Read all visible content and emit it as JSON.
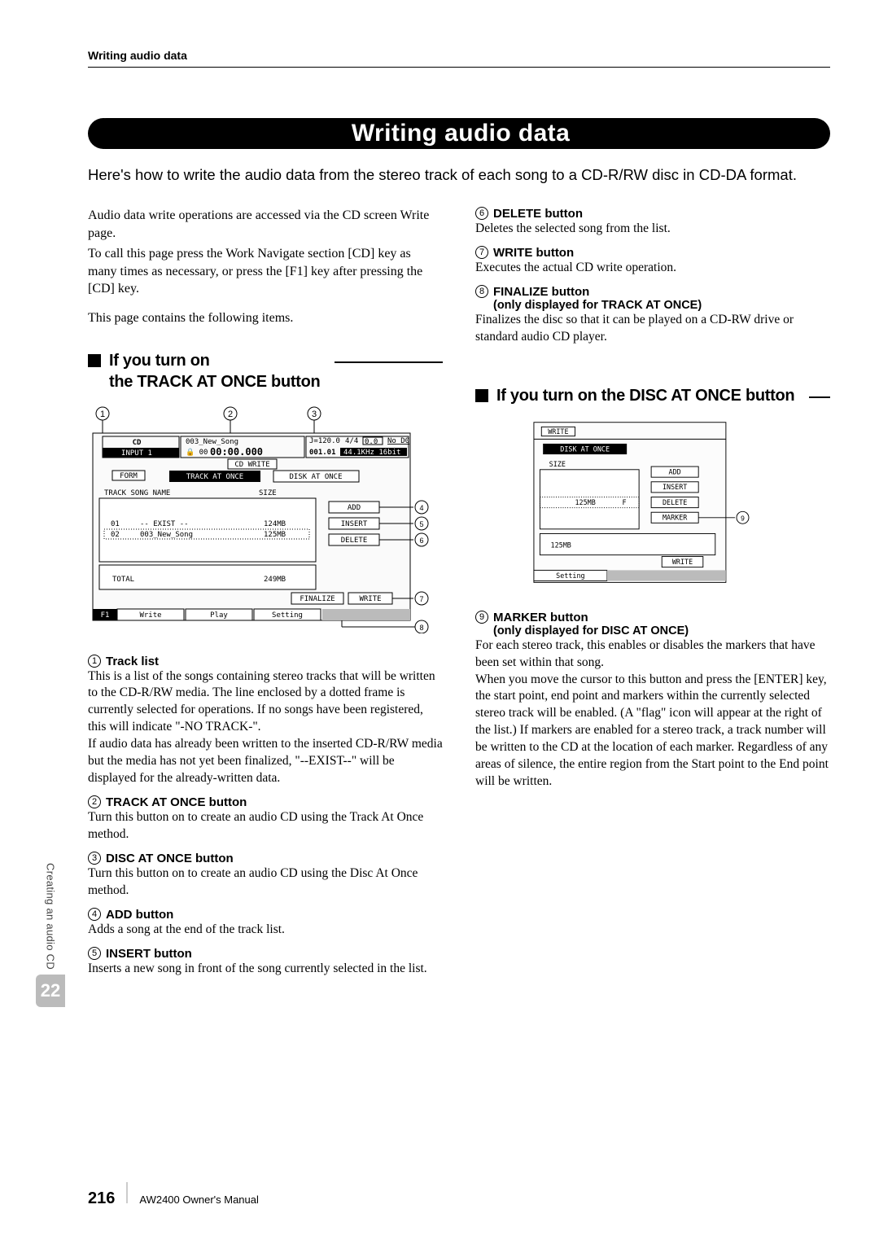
{
  "header": {
    "running_head": "Writing audio data"
  },
  "title": "Writing audio data",
  "intro": "Here's how to write the audio data from the stereo track of each song to a CD-R/RW disc in CD-DA format.",
  "left": {
    "para1": "Audio data write operations are accessed via the CD screen Write page.",
    "para2": "To call this page press the Work Navigate section [CD] key as many times as necessary, or press the [F1] key after pressing the [CD] key.",
    "para3": "This page contains the following items.",
    "section_heading_l1": "If you turn on",
    "section_heading_l2": "the TRACK AT ONCE button",
    "screenshot1": {
      "callouts": {
        "c1": "1",
        "c2": "2",
        "c3": "3",
        "c4": "4",
        "c5": "5",
        "c6": "6",
        "c7": "7",
        "c8": "8"
      },
      "top": {
        "screen_label": "CD",
        "input_label": "INPUT 1",
        "song": "003_New_Song",
        "time": "00:00.000",
        "lock": "🔒 00",
        "bpm": "J=120.0",
        "sig": "4/4",
        "bar": "001.01",
        "db": "No D0",
        "db2": "0.0",
        "sr": "44.1KHz 16bit"
      },
      "tabs": {
        "cd_write": "CD WRITE",
        "form": "FORM",
        "track_at_once": "TRACK AT ONCE",
        "disk_at_once": "DISK AT ONCE"
      },
      "labels": {
        "list_header1": "TRACK SONG NAME",
        "list_header2": "SIZE"
      },
      "rows": [
        {
          "num": "01",
          "name": "-- EXIST --",
          "size": "124MB"
        },
        {
          "num": "02",
          "name": "003_New_Song",
          "size": "125MB"
        }
      ],
      "buttons": {
        "add": "ADD",
        "insert": "INSERT",
        "delete": "DELETE",
        "finalize": "FINALIZE",
        "write": "WRITE"
      },
      "total": {
        "label": "TOTAL",
        "value": "249MB"
      },
      "footer_tabs": {
        "f1": "F1",
        "write": "Write",
        "play": "Play",
        "setting": "Setting"
      }
    },
    "items": {
      "i1": {
        "num": "1",
        "title": "Track list",
        "body": "This is a list of the songs containing stereo tracks that will be written to the CD-R/RW media. The line enclosed by a dotted frame is currently selected for operations. If no songs have been registered, this will indicate \"-NO TRACK-\".",
        "body2": "If audio data has already been written to the inserted CD-R/RW media but the media has not yet been finalized, \"--EXIST--\" will be displayed for the already-written data."
      },
      "i2": {
        "num": "2",
        "title": "TRACK AT ONCE button",
        "body": "Turn this button on to create an audio CD using the Track At Once method."
      },
      "i3": {
        "num": "3",
        "title": "DISC AT ONCE button",
        "body": "Turn this button on to create an audio CD using the Disc At Once method."
      },
      "i4": {
        "num": "4",
        "title": "ADD button",
        "body": "Adds a song at the end of the track list."
      },
      "i5": {
        "num": "5",
        "title": "INSERT button",
        "body": "Inserts a new song in front of the song currently selected in the list."
      }
    }
  },
  "right": {
    "items_top": {
      "i6": {
        "num": "6",
        "title": "DELETE button",
        "body": "Deletes the selected song from the list."
      },
      "i7": {
        "num": "7",
        "title": "WRITE button",
        "body": "Executes the actual CD write operation."
      },
      "i8": {
        "num": "8",
        "title": "FINALIZE button",
        "sub": "(only displayed for TRACK AT ONCE)",
        "body": "Finalizes the disc so that it can be played on a CD-RW drive or standard audio CD player."
      }
    },
    "section_heading": "If you turn on the DISC AT ONCE button",
    "screenshot2": {
      "callout9": "9",
      "labels": {
        "write_tab": "WRITE",
        "dao": "DISK AT ONCE",
        "size": "SIZE",
        "total": "125MB"
      },
      "row_size": "125MB",
      "row_flag": "F",
      "buttons": {
        "add": "ADD",
        "insert": "INSERT",
        "delete": "DELETE",
        "marker": "MARKER",
        "write": "WRITE"
      },
      "footer": "Setting"
    },
    "item9": {
      "num": "9",
      "title": "MARKER button",
      "sub": "(only displayed for DISC AT ONCE)",
      "body": "For each stereo track, this enables or disables the markers that have been set within that song.",
      "body2": "When you move the cursor to this button and press the [ENTER] key, the start point, end point and markers within the currently selected stereo track will be enabled. (A \"flag\" icon will appear at the right of the list.) If markers are enabled for a stereo track, a track number will be written to the CD at the location of each marker. Regardless of any areas of silence, the entire region from the Start point to the End point will be written."
    }
  },
  "sidebar": {
    "label": "Creating an audio CD",
    "chapter": "22"
  },
  "footer": {
    "page": "216",
    "manual": "AW2400  Owner's Manual"
  }
}
